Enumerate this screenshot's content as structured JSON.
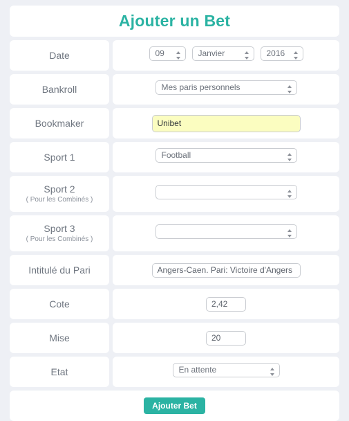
{
  "title": "Ajouter un Bet",
  "accent_color": "#2bb3a3",
  "background_color": "#eef0f5",
  "card_color": "#ffffff",
  "autofill_color": "#fbfdc0",
  "rows": {
    "date": {
      "label": "Date",
      "day": "09",
      "month": "Janvier",
      "year": "2016"
    },
    "bankroll": {
      "label": "Bankroll",
      "value": "Mes paris personnels"
    },
    "bookmaker": {
      "label": "Bookmaker",
      "value": "Unibet"
    },
    "sport1": {
      "label": "Sport 1",
      "value": "Football"
    },
    "sport2": {
      "label": "Sport 2",
      "sublabel": "( Pour les Combinés )",
      "value": ""
    },
    "sport3": {
      "label": "Sport 3",
      "sublabel": "( Pour les Combinés )",
      "value": ""
    },
    "intitule": {
      "label": "Intitulé du Pari",
      "value": "Angers-Caen. Pari: Victoire d'Angers"
    },
    "cote": {
      "label": "Cote",
      "value": "2,42"
    },
    "mise": {
      "label": "Mise",
      "value": "20"
    },
    "etat": {
      "label": "Etat",
      "value": "En attente"
    }
  },
  "submit": {
    "label": "Ajouter Bet"
  }
}
